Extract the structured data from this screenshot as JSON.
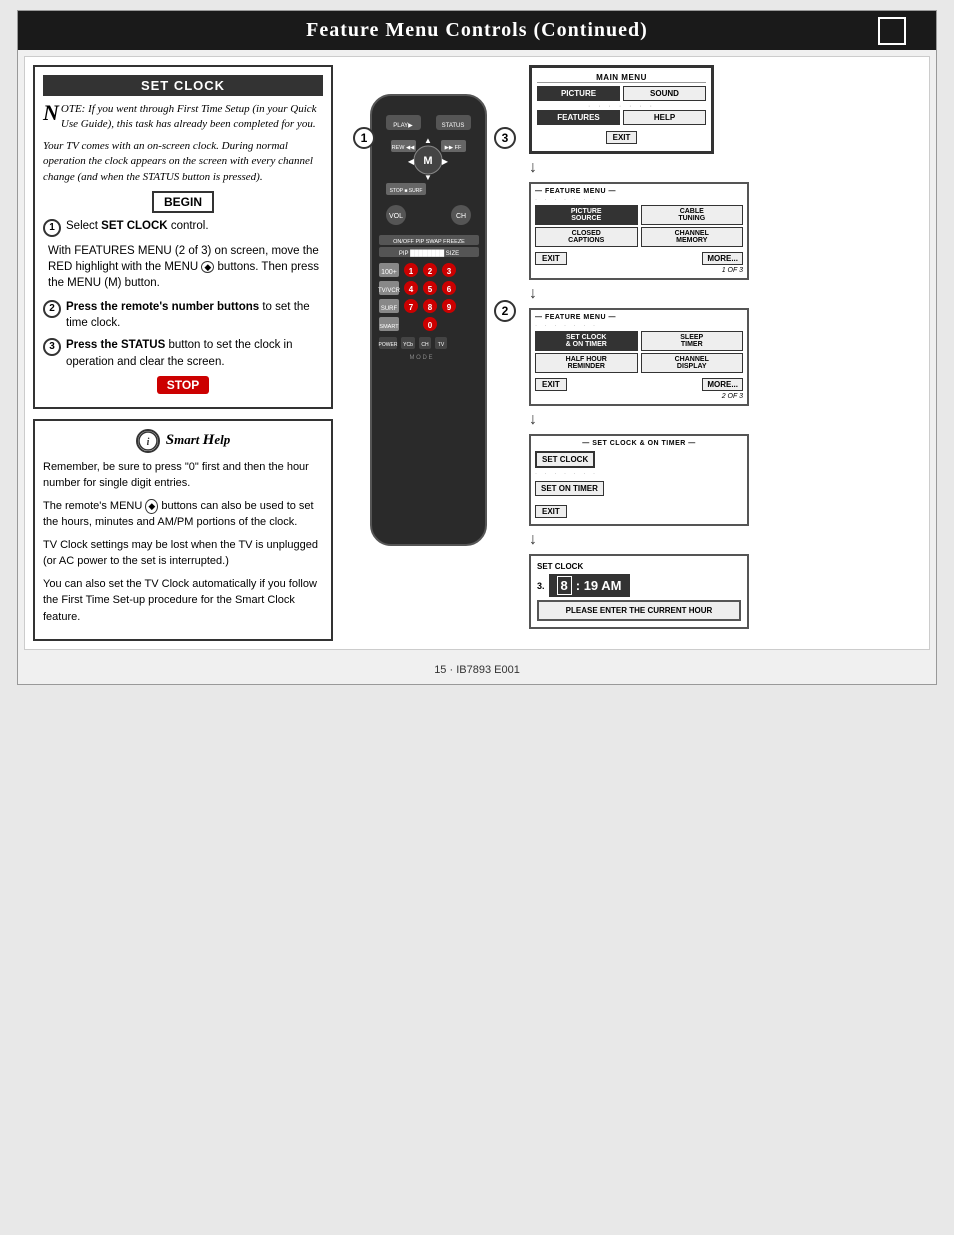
{
  "header": {
    "title": "Feature Menu Controls (Continued)",
    "box_label": ""
  },
  "set_clock": {
    "title": "SET CLOCK",
    "note": {
      "drop_letter": "N",
      "text": "OTE: If you went through First Time Setup (in your Quick Use Guide), this task has already been completed for you."
    },
    "body_text": "Your TV comes with an on-screen clock. During normal operation the clock appears on the screen with every channel change (and when the STATUS button is pressed).",
    "begin_label": "BEGIN",
    "steps": [
      {
        "num": "1",
        "text": "Select SET CLOCK control."
      },
      {
        "num": "",
        "text": "With FEATURES MENU (2 of 3) on screen, move the RED highlight with the MENU ◆ buttons. Then press the MENU (M) button."
      },
      {
        "num": "2",
        "text": "Press the remote's number buttons to set the time clock."
      },
      {
        "num": "3",
        "text": "Press the STATUS button to set the clock in operation and clear the screen."
      }
    ],
    "stop_label": "STOP"
  },
  "smart_help": {
    "title": "Smart Help",
    "paragraphs": [
      "Remember, be sure to press \"0\" first and then the hour number for single digit entries.",
      "The remote's MENU ◆ buttons can also be used to set the hours, minutes and AM/PM portions of the clock.",
      "TV Clock settings may be lost when the TV is unplugged (or AC power to the set is interrupted.)",
      "You can also set the TV Clock automatically if you follow the First Time Set-up procedure for the Smart Clock feature."
    ]
  },
  "menus": {
    "main_menu": {
      "label": "MAIN MENU",
      "items": [
        "PICTURE",
        "SOUND",
        "FEATURES",
        "HELP",
        "EXIT"
      ]
    },
    "feature_menu_1": {
      "label": "FEATURE MENU",
      "items": [
        {
          "label": "PICTURE SOURCE",
          "highlighted": true
        },
        {
          "label": "CABLE TUNING",
          "highlighted": false
        },
        {
          "label": "CLOSED CAPTIONS",
          "highlighted": false
        },
        {
          "label": "CHANNEL MEMORY",
          "highlighted": false
        }
      ],
      "exit": "EXIT",
      "more": "MORE...",
      "page": "1 OF 3"
    },
    "feature_menu_2": {
      "label": "FEATURE MENU",
      "items": [
        {
          "label": "SET CLOCK & ON TIMER",
          "highlighted": true
        },
        {
          "label": "SLEEP TIMER",
          "highlighted": false
        },
        {
          "label": "HALF HOUR REMINDER",
          "highlighted": false
        },
        {
          "label": "CHANNEL DISPLAY",
          "highlighted": false
        }
      ],
      "exit": "EXIT",
      "more": "MORE...",
      "page": "2 OF 3"
    },
    "set_clock_timer": {
      "label": "SET CLOCK & ON TIMER",
      "items": [
        "SET CLOCK",
        "SET ON TIMER"
      ],
      "exit": "EXIT"
    },
    "set_clock_final": {
      "label": "SET CLOCK",
      "step_num": "3",
      "time": "8: 19 AM",
      "message": "PLEASE ENTER THE CURRENT HOUR"
    }
  },
  "footer": {
    "text": "15 · IB7893 E001"
  },
  "remote": {
    "label": "Remote Control",
    "step1_label": "1",
    "step2_label": "2",
    "step3_label": "3"
  }
}
